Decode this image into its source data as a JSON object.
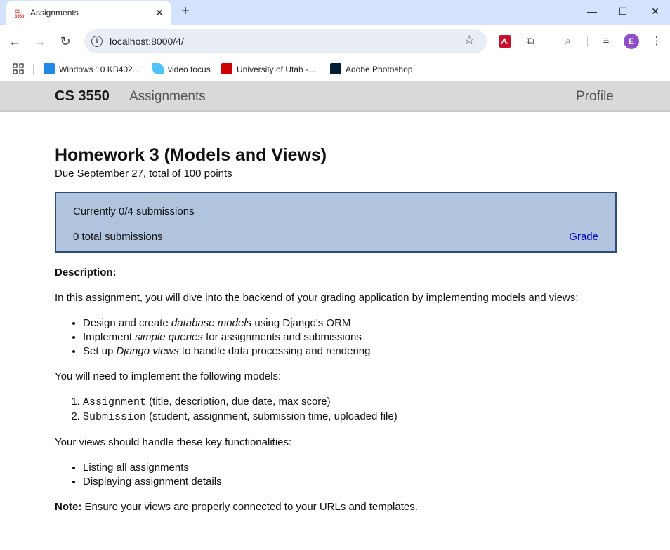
{
  "browser": {
    "tab_title": "Assignments",
    "tab_close": "✕",
    "new_tab": "+",
    "url": "localhost:8000/4/",
    "profile_initial": "E",
    "bookmarks": [
      {
        "label": "Windows 10 KB402...",
        "color": "#1e88e5"
      },
      {
        "label": "video focus",
        "color": "#4fc3f7"
      },
      {
        "label": "University of Utah -...",
        "color": "#cc0000"
      },
      {
        "label": "Adobe Photoshop",
        "color": "#001e36"
      }
    ]
  },
  "nav": {
    "brand": "CS 3550",
    "assignments": "Assignments",
    "profile": "Profile"
  },
  "assignment": {
    "title": "Homework 3 (Models and Views)",
    "due": "Due September 27, total of 100 points",
    "current_submissions": "Currently 0/4 submissions",
    "total_submissions": "0 total submissions",
    "grade_link": "Grade"
  },
  "description": {
    "label": "Description:",
    "intro": "In this assignment, you will dive into the backend of your grading application by implementing models and views:",
    "bullets": [
      {
        "pre": "Design and create ",
        "em": "database models",
        "post": " using Django's ORM"
      },
      {
        "pre": "Implement ",
        "em": "simple queries",
        "post": " for assignments and submissions"
      },
      {
        "pre": "Set up ",
        "em": "Django views",
        "post": " to handle data processing and rendering"
      }
    ],
    "models_intro": "You will need to implement the following models:",
    "models": [
      {
        "code": "Assignment",
        "fields": " (title, description, due date, max score)"
      },
      {
        "code": "Submission",
        "fields": " (student, assignment, submission time, uploaded file)"
      }
    ],
    "views_intro": "Your views should handle these key functionalities:",
    "views": [
      "Listing all assignments",
      "Displaying assignment details"
    ],
    "note_label": "Note:",
    "note_text": " Ensure your views are properly connected to your URLs and templates."
  },
  "colors": {
    "status_box_bg": "#b0c4de",
    "status_box_border": "#2c4a7a",
    "navbar_bg": "#d9d9d9",
    "link": "#0000cc"
  }
}
